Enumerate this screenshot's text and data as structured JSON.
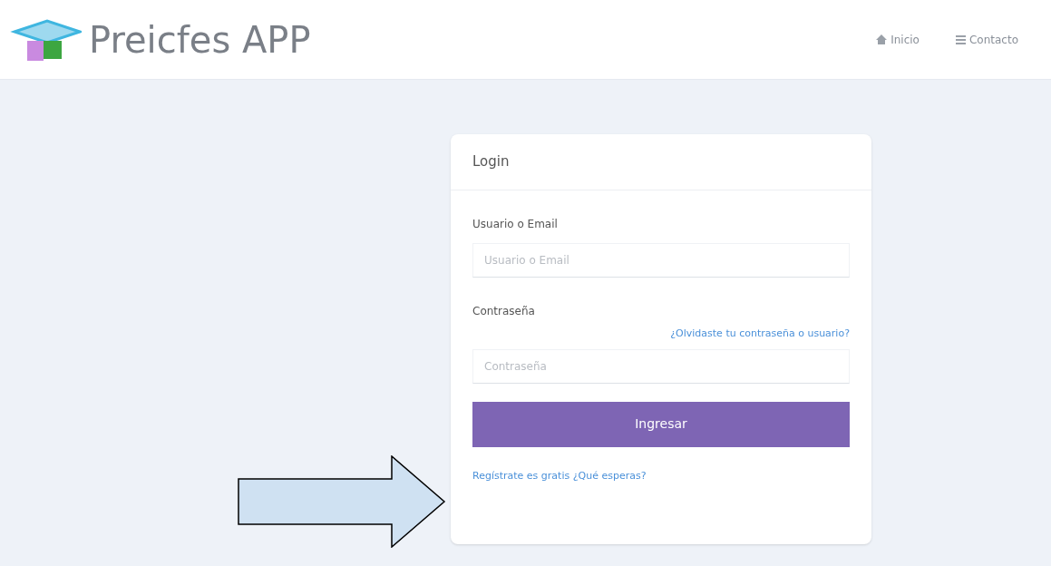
{
  "header": {
    "brand": "Preicfes APP",
    "nav": [
      {
        "label": "Inicio"
      },
      {
        "label": "Contacto"
      }
    ]
  },
  "login": {
    "title": "Login",
    "fields": [
      {
        "label": "Usuario o Email",
        "placeholder": "Usuario o Email"
      },
      {
        "label": "Contraseña",
        "link": "¿Olvidaste tu contraseña o usuario?",
        "placeholder": "Contraseña"
      }
    ],
    "button": "Ingresar",
    "register_link": "Regístrate es gratis ¿Qué esperas?"
  }
}
